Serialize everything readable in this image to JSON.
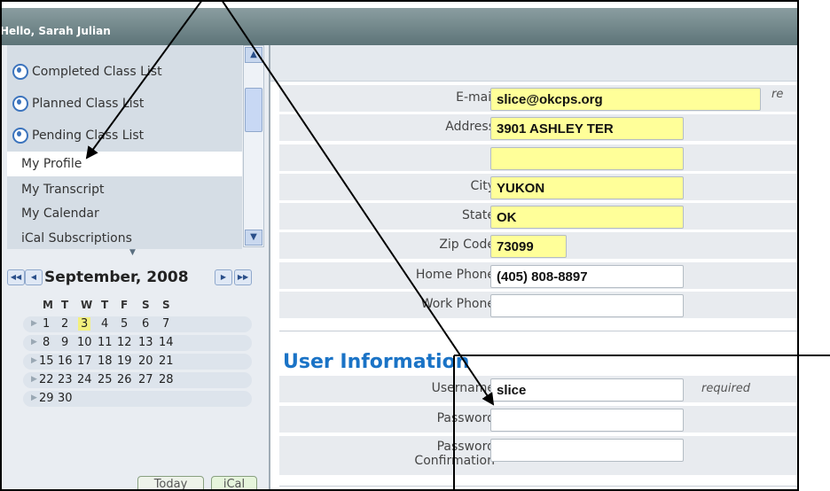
{
  "header": {
    "greeting": "Hello, Sarah Julian"
  },
  "nav": {
    "items": [
      {
        "label": "Completed Class List",
        "icon": "class-list-icon"
      },
      {
        "label": "Planned Class List",
        "icon": "class-list-icon"
      },
      {
        "label": "Pending Class List",
        "icon": "class-list-icon"
      },
      {
        "label": "My Profile",
        "selected": true
      },
      {
        "label": "My Transcript"
      },
      {
        "label": "My Calendar"
      },
      {
        "label": "iCal Subscriptions"
      }
    ]
  },
  "calendar": {
    "month": "September, 2008",
    "weekdays": [
      "M",
      "T",
      "W",
      "T",
      "F",
      "S",
      "S"
    ],
    "weeks": [
      [
        "1",
        "2",
        "3",
        "4",
        "5",
        "6",
        "7"
      ],
      [
        "8",
        "9",
        "10",
        "11",
        "12",
        "13",
        "14"
      ],
      [
        "15",
        "16",
        "17",
        "18",
        "19",
        "20",
        "21"
      ],
      [
        "22",
        "23",
        "24",
        "25",
        "26",
        "27",
        "28"
      ],
      [
        "29",
        "30"
      ]
    ],
    "today": "3",
    "today_button": "Today",
    "ical_button": "iCal"
  },
  "profile": {
    "email_label": "E-mail",
    "email": "slice@okcps.org",
    "email_note": "re",
    "address_label": "Address",
    "address": "3901 ASHLEY TER",
    "address2": "",
    "city_label": "City",
    "city": "YUKON",
    "state_label": "State",
    "state": "OK",
    "zip_label": "Zip Code",
    "zip": "73099",
    "home_phone_label": "Home Phone",
    "home_phone": "(405) 808-8897",
    "work_phone_label": "Work Phone",
    "work_phone": ""
  },
  "user_info": {
    "title": "User Information",
    "username_label": "Username",
    "username": "slice",
    "username_note": "required",
    "password_label": "Password",
    "password": "",
    "confirm_label": "Password Confirmation",
    "confirm": ""
  }
}
